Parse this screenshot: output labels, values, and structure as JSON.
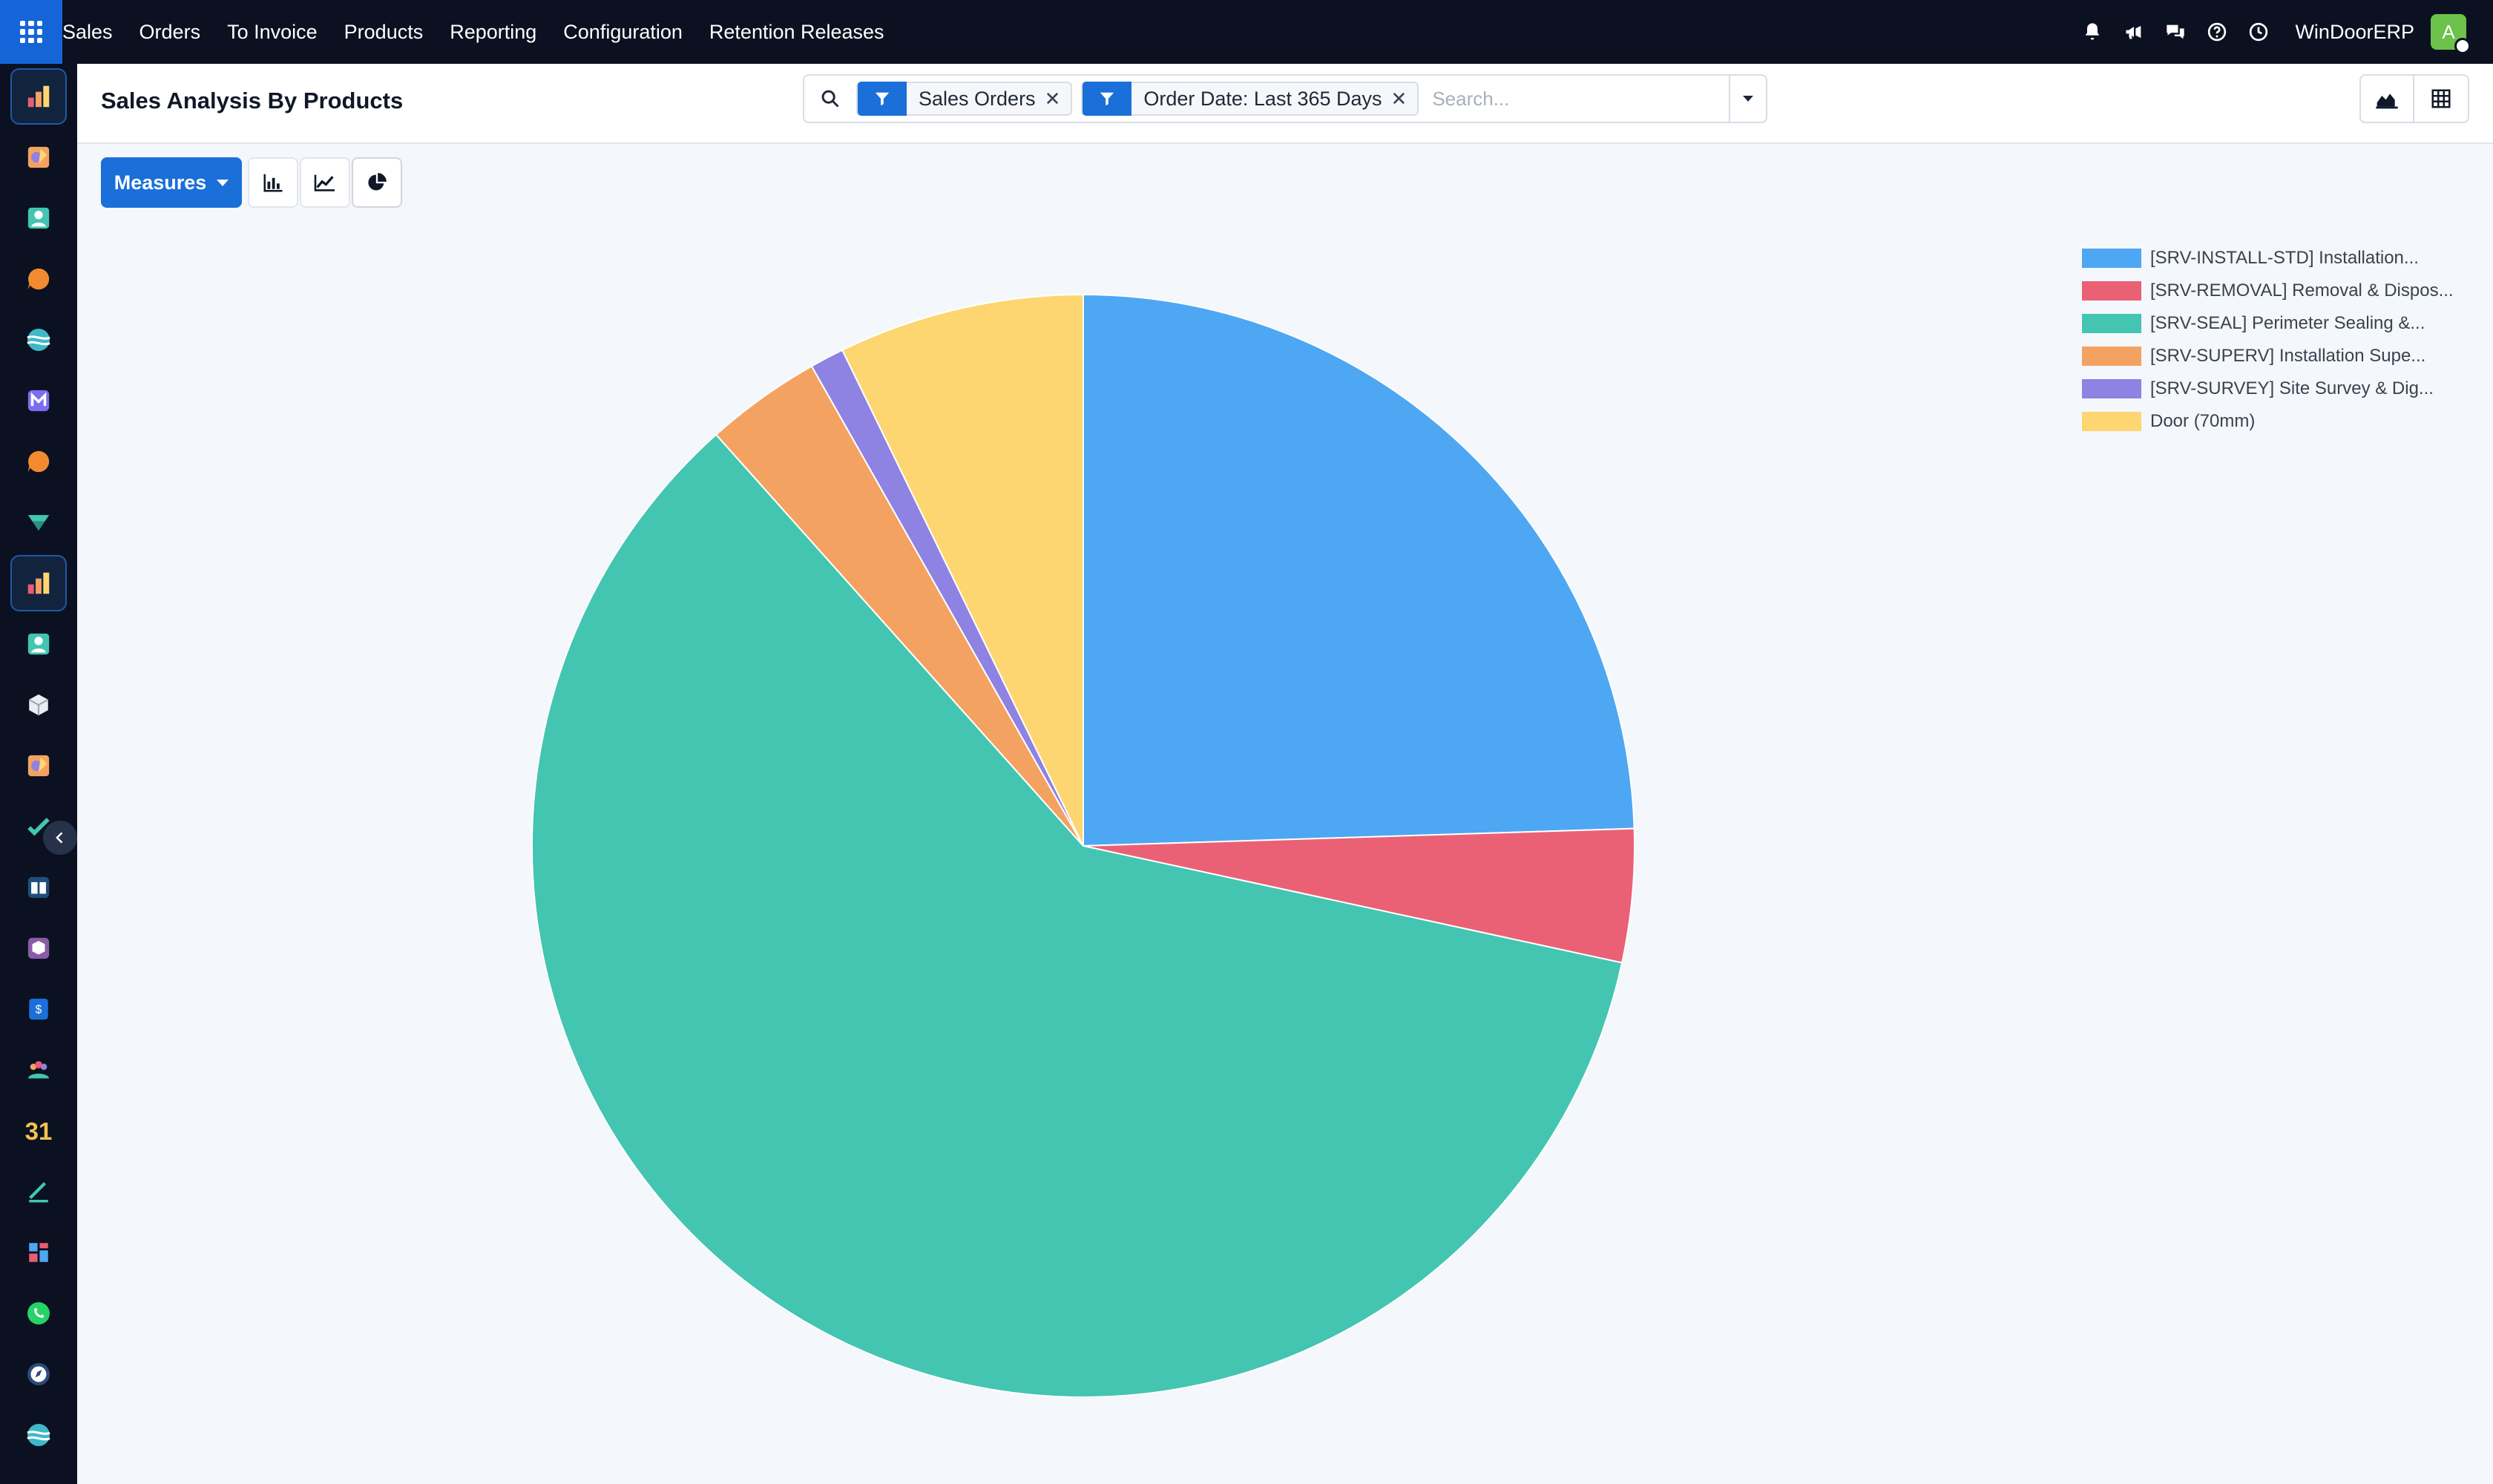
{
  "topbar": {
    "menu": [
      "Sales",
      "Orders",
      "To Invoice",
      "Products",
      "Reporting",
      "Configuration",
      "Retention Releases"
    ],
    "company": "WinDoorERP",
    "avatar_initial": "A",
    "icons": [
      "bell-icon",
      "megaphone-icon",
      "chat-icon",
      "help-icon",
      "clock-icon"
    ]
  },
  "sidebar": {
    "apps": [
      "sales-app",
      "paint-app",
      "contacts-app",
      "discuss-app",
      "website-app",
      "email-marketing-app",
      "livechat-app",
      "project-app",
      "sales-app",
      "contacts-app",
      "inventory-app",
      "paint-app",
      "todo-app",
      "knowledge-app",
      "product-app",
      "invoicing-app",
      "employees-app",
      "calendar-app",
      "sign-app",
      "dashboards-app",
      "whatsapp-app",
      "time-off-app",
      "website-app"
    ],
    "active_index": 8
  },
  "control_panel": {
    "title": "Sales Analysis By Products",
    "facets": [
      {
        "label": "Sales Orders"
      },
      {
        "label": "Order Date: Last 365 Days"
      }
    ],
    "search_placeholder": "Search..."
  },
  "toolbar": {
    "measures_label": "Measures"
  },
  "colors": {
    "accent": "#1a6fd8",
    "nav_bg": "#0b1120"
  },
  "chart_data": {
    "type": "pie",
    "categories": [
      "[SRV-INSTALL-STD] Installation...",
      "[SRV-REMOVAL] Removal & Dispos...",
      "[SRV-SEAL] Perimeter Sealing &...",
      "[SRV-SUPERV] Installation Supe...",
      "[SRV-SURVEY] Site Survey & Dig...",
      "Door (70mm)"
    ],
    "values": [
      24.5,
      3.9,
      60.0,
      3.4,
      1.0,
      7.2
    ],
    "colors": [
      "#4ea7f2",
      "#ea6175",
      "#43c5b1",
      "#f4a261",
      "#8e82e3",
      "#fdd671"
    ],
    "legend_position": "top-right"
  }
}
